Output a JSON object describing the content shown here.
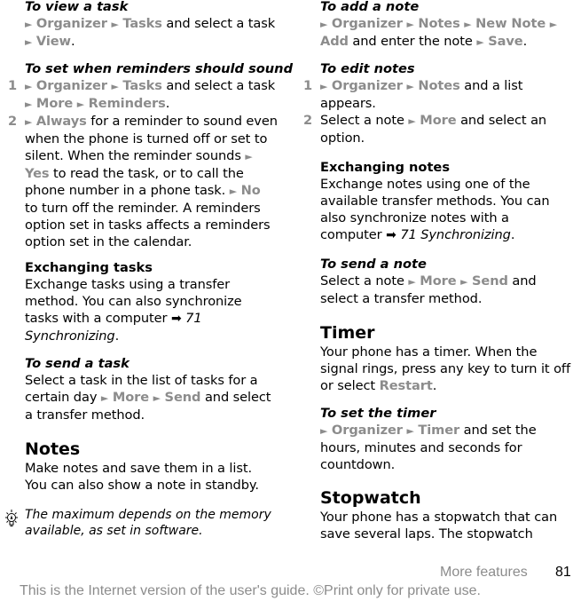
{
  "left": {
    "view_task": {
      "heading": "To view a task",
      "line1": {
        "m1": "Organizer",
        "m2": "Tasks",
        "t1": " and select a task"
      },
      "line2": {
        "m1": "View",
        "t1": "."
      }
    },
    "reminders": {
      "heading": "To set when reminders should sound",
      "step1": {
        "num": "1",
        "m1": "Organizer",
        "m2": "Tasks",
        "t1": " and select a task",
        "m3": "More",
        "m4": "Reminders",
        "t2": "."
      },
      "step2": {
        "num": "2",
        "m1": "Always",
        "t1": " for a reminder to sound even",
        "l2": "when the phone is turned off or set to",
        "l3": "silent. When the reminder sounds ",
        "m2": "Yes",
        "t4": " to read the task, or to call the",
        "t5": "phone number in a phone task. ",
        "m3": "No",
        "l6": "to turn off the reminder. A reminders",
        "l7": "option set in tasks affects a reminders",
        "l8": "option set in the calendar."
      }
    },
    "exchanging_tasks": {
      "heading": "Exchanging tasks",
      "l1": "Exchange tasks using a transfer",
      "l2": "method. You can also synchronize",
      "l3": "tasks with a computer ",
      "ref_page": "71",
      "ref_title": "Synchronizing",
      "end": "."
    },
    "send_task": {
      "heading": "To send a task",
      "l1": "Select a task in the list of tasks for a",
      "l2a": "certain day ",
      "m1": "More",
      "m2": "Send",
      "l2b": " and select",
      "l3": "a transfer method."
    },
    "notes": {
      "heading": "Notes",
      "l1": "Make notes and save them in a list.",
      "l2": "You can also show a note in standby."
    },
    "tip": {
      "icon": "lightbulb-icon",
      "l1": "The maximum depends on the memory",
      "l2": "available, as set in software."
    }
  },
  "right": {
    "add_note": {
      "heading": "To add a note",
      "m1": "Organizer",
      "m2": "Notes",
      "m3": "New Note",
      "m4": "Add",
      "t1": " and enter the note ",
      "m5": "Save",
      "t2": "."
    },
    "edit_notes": {
      "heading": "To edit notes",
      "step1": {
        "num": "1",
        "m1": "Organizer",
        "m2": "Notes",
        "t1": " and a list",
        "l2": "appears."
      },
      "step2": {
        "num": "2",
        "t1": "Select a note ",
        "m1": "More",
        "t2": " and select an",
        "l2": "option."
      }
    },
    "exchanging_notes": {
      "heading": "Exchanging notes",
      "l1": "Exchange notes using one of the",
      "l2": "available transfer methods. You can",
      "l3": "also synchronize notes with a",
      "l4": "computer ",
      "ref_page": "71",
      "ref_title": "Synchronizing",
      "end": "."
    },
    "send_note": {
      "heading": "To send a note",
      "l1a": "Select a note ",
      "m1": "More",
      "m2": "Send",
      "l1b": " and",
      "l2": "select a transfer method."
    },
    "timer": {
      "heading": "Timer",
      "l1": "Your phone has a timer. When the",
      "l2": "signal rings, press any key to turn it off",
      "l3a": "or select ",
      "m1": "Restart",
      "l3b": "."
    },
    "set_timer": {
      "heading": "To set the timer",
      "m1": "Organizer",
      "m2": "Timer",
      "t1": " and set the",
      "l2": "hours, minutes and seconds for",
      "l3": "countdown."
    },
    "stopwatch": {
      "heading": "Stopwatch",
      "l1": "Your phone has a stopwatch that can",
      "l2": "save several laps. The stopwatch"
    }
  },
  "footer": {
    "section": "More features",
    "page": "81",
    "notice": "This is the Internet version of the user's guide. ©Print only for private use."
  },
  "glyphs": {
    "menu_arrow": "►",
    "ref_arrow": "➡"
  }
}
